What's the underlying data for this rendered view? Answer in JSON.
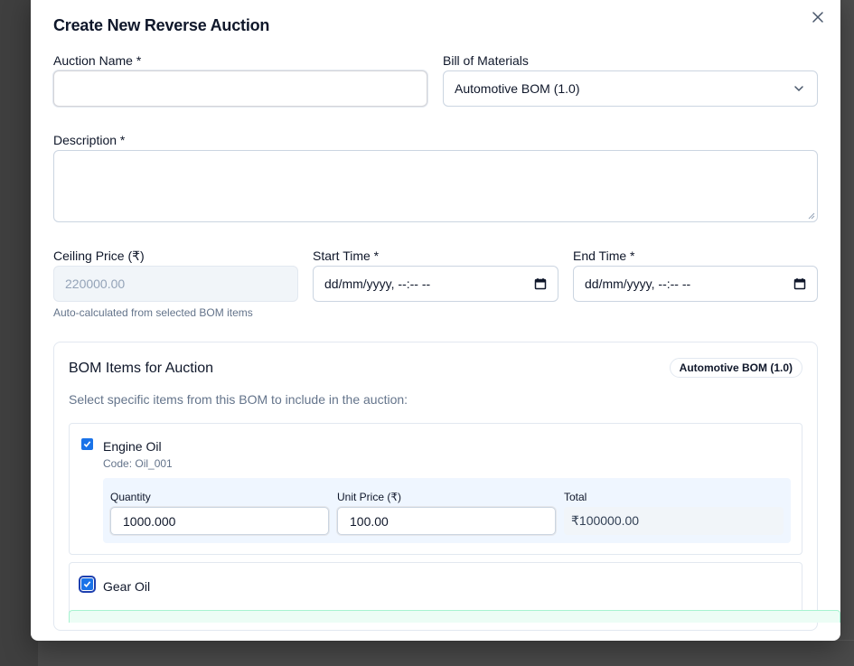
{
  "dialog": {
    "title": "Create New Reverse Auction",
    "close_icon": "close-icon"
  },
  "form": {
    "auction_name": {
      "label": "Auction Name *",
      "value": ""
    },
    "bom": {
      "label": "Bill of Materials",
      "selected": "Automotive BOM (1.0)"
    },
    "description": {
      "label": "Description *",
      "value": ""
    },
    "ceiling_price": {
      "label": "Ceiling Price (₹)",
      "placeholder": "220000.00",
      "hint": "Auto-calculated from selected BOM items"
    },
    "start_time": {
      "label": "Start Time *",
      "value": "dd/mm/yyyy, --:-- --"
    },
    "end_time": {
      "label": "End Time *",
      "value": "dd/mm/yyyy, --:-- --"
    }
  },
  "bom_items": {
    "title": "BOM Items for Auction",
    "badge": "Automotive BOM (1.0)",
    "subtitle": "Select specific items from this BOM to include in the auction:",
    "field_labels": {
      "quantity": "Quantity",
      "unit_price": "Unit Price (₹)",
      "total": "Total"
    },
    "items": [
      {
        "name": "Engine Oil",
        "code": "Code: Oil_001",
        "checked": true,
        "quantity": "1000.000",
        "unit_price": "100.00",
        "total": "₹100000.00"
      },
      {
        "name": "Gear Oil",
        "checked": true
      }
    ]
  },
  "colors": {
    "accent": "#1a73e8",
    "field_bg": "#eff6ff"
  }
}
